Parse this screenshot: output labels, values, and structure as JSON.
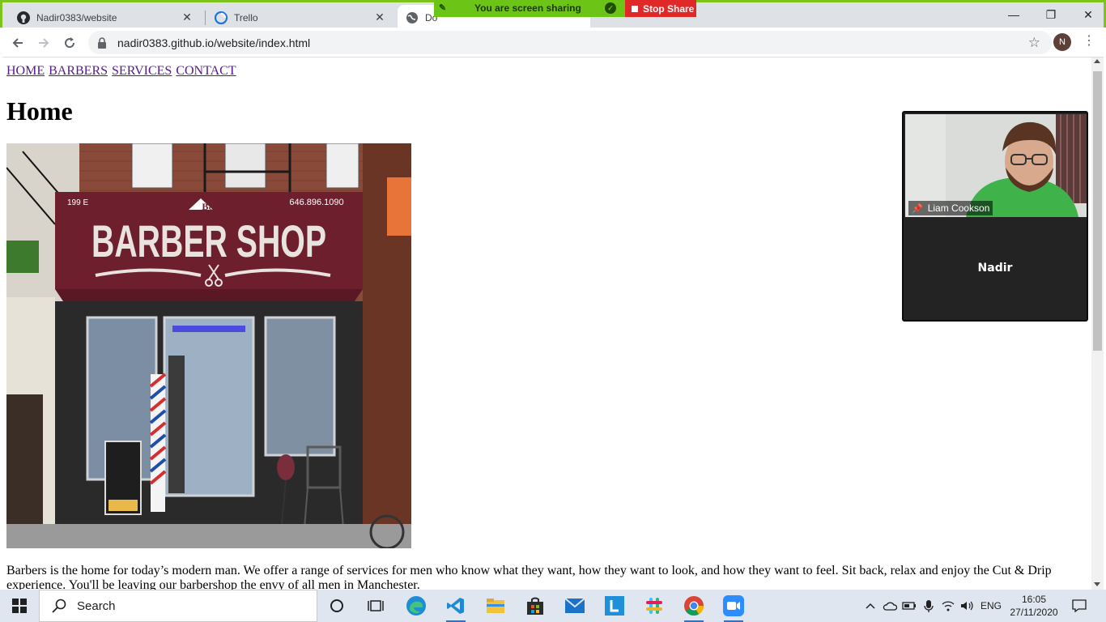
{
  "browser": {
    "tabs": [
      {
        "label": "Nadir0383/website",
        "icon": "github-icon"
      },
      {
        "label": "Trello",
        "icon": "trello-icon"
      },
      {
        "label": "Do",
        "icon": "globe-icon"
      }
    ],
    "share_bar": {
      "message": "You are screen sharing",
      "stop_label": "Stop Share"
    },
    "url": "nadir0383.github.io/website/index.html",
    "profile_initial": "N"
  },
  "page": {
    "nav": [
      "HOME",
      "BARBERS",
      "SERVICES",
      "CONTACT"
    ],
    "heading": "Home",
    "hero_sign": {
      "address": "199 E",
      "logo": "B&H",
      "title": "BARBER SHOP",
      "phone": "646.896.1090"
    },
    "intro": "Barbers is the home for today’s modern man. We offer a range of services for men who know what they want, how they want to look, and how they want to feel. Sit back, relax and enjoy the Cut & Drip experience. You'll be leaving our barbershop the envy of all men in Manchester."
  },
  "zoom": {
    "participant_name": "Liam Cookson",
    "self_name": "Nadir"
  },
  "taskbar": {
    "search_placeholder": "Search",
    "language": "ENG",
    "time": "16:05",
    "date": "27/11/2020"
  },
  "colors": {
    "share_green": "#6cc417",
    "stop_red": "#e02828",
    "link_visited": "#551a8b",
    "awning": "#6e1f2e"
  }
}
